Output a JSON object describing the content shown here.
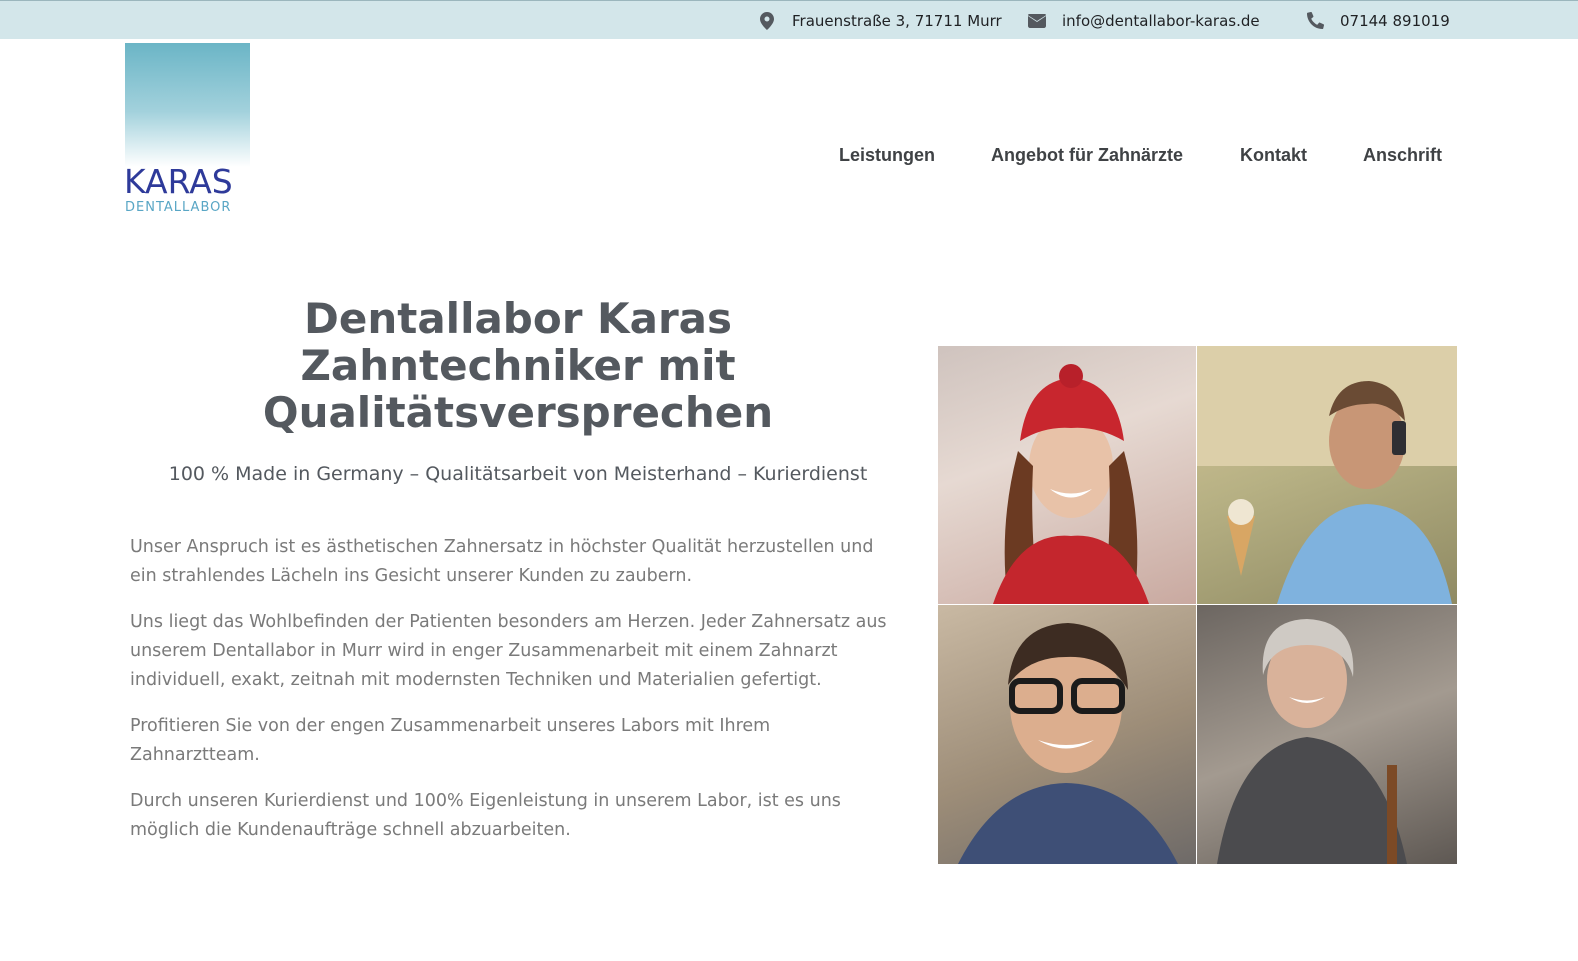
{
  "topbar": {
    "address": "Frauenstraße 3, 71711 Murr",
    "email": "info@dentallabor-karas.de",
    "phone": "07144 891019",
    "background_color": "#d3e6ea"
  },
  "logo": {
    "name": "KARAS",
    "subtitle": "DENTALLABOR",
    "name_color": "#2e3a9a",
    "subtitle_color": "#59a6c5"
  },
  "nav": {
    "items": [
      {
        "label": "Leistungen"
      },
      {
        "label": "Angebot für Zahnärzte"
      },
      {
        "label": "Kontakt"
      },
      {
        "label": "Anschrift"
      }
    ]
  },
  "hero": {
    "title_line1": "Dentallabor Karas",
    "title_line2": "Zahntechniker mit",
    "title_line3": "Qualitätsversprechen",
    "subline": "100 % Made in Germany – Qualitätsarbeit von Meisterhand – Kurierdienst",
    "paragraphs": [
      "Unser Anspruch ist es ästhetischen Zahnersatz in höchster Qualität herzustellen und ein strahlendes Lächeln ins Gesicht unserer Kunden zu zaubern.",
      "Uns liegt das Wohlbefinden der Patienten besonders am Herzen. Jeder Zahnersatz aus unserem Dentallabor in Murr wird in enger Zusammenarbeit mit einem Zahnarzt individuell, exakt, zeitnah mit modernsten Techniken und Materialien gefertigt.",
      "Profitieren Sie von der engen Zusammenarbeit unseres Labors mit Ihrem Zahnarztteam.",
      "Durch unseren Kurierdienst und 100% Eigenleistung in unserem Labor, ist es uns möglich die Kundenaufträge schnell abzuarbeiten."
    ]
  },
  "icons": {
    "address": "map-marker-icon",
    "email": "envelope-icon",
    "phone": "phone-icon"
  }
}
